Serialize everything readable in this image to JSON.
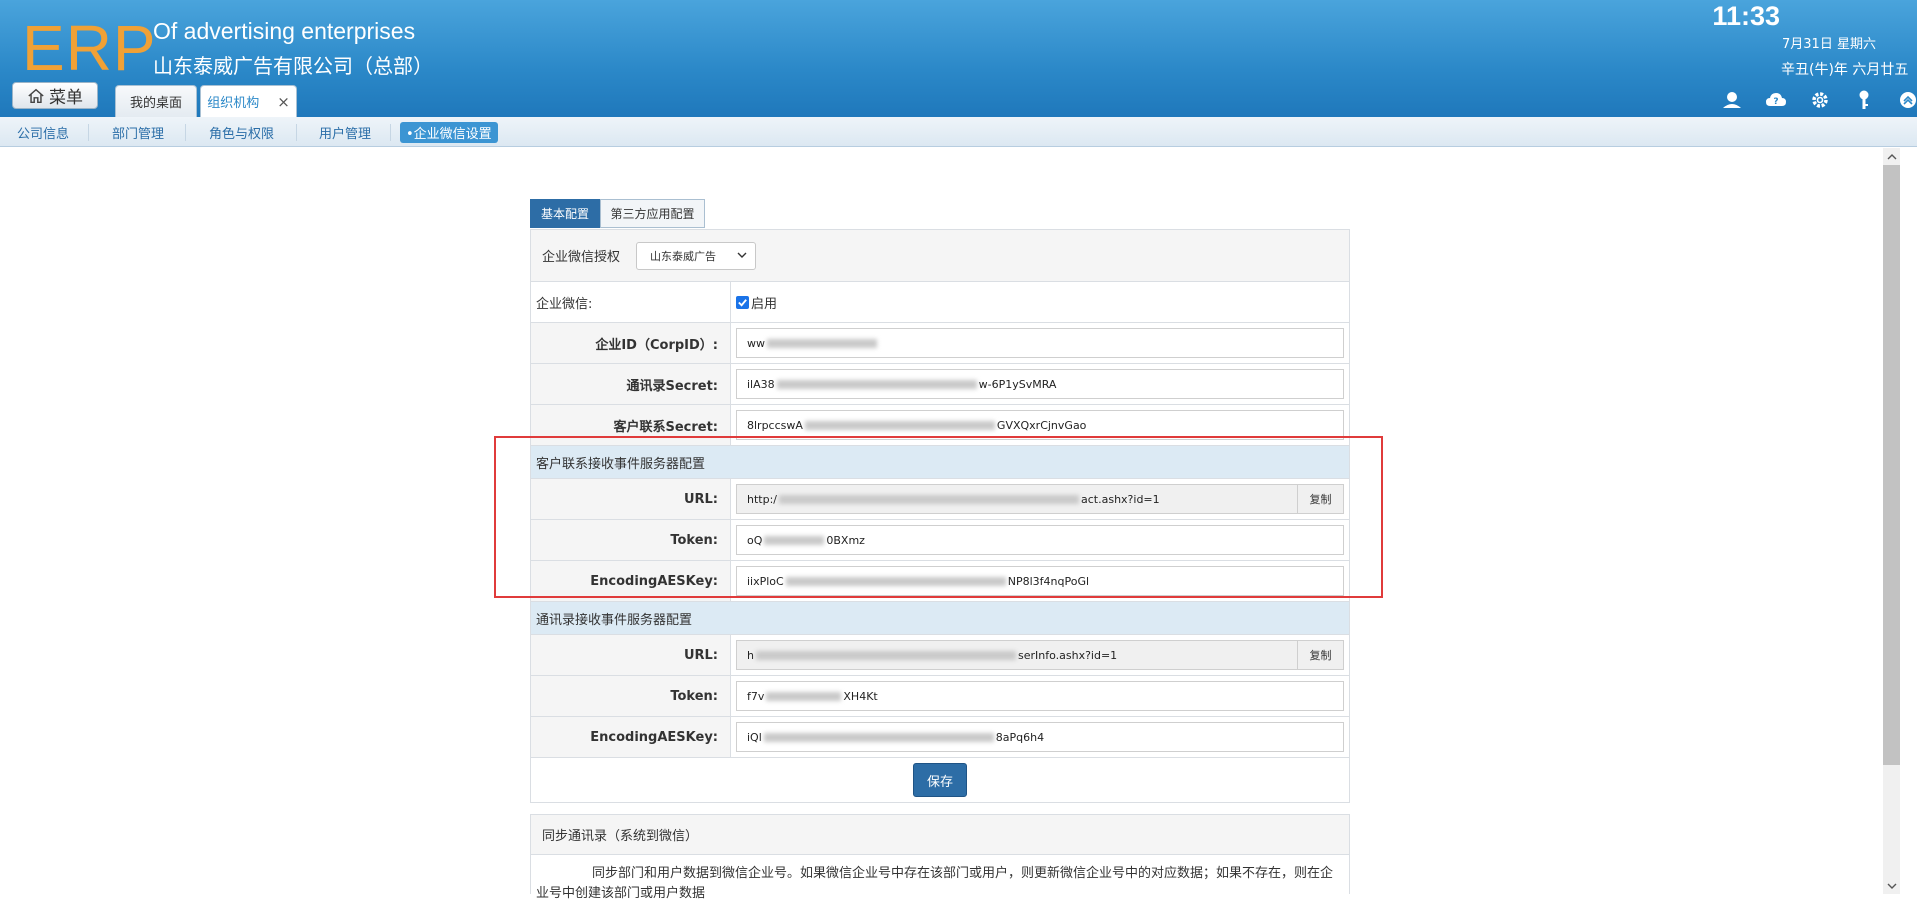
{
  "header": {
    "logo": "ERP",
    "title_en": "Of advertising enterprises",
    "title_cn": "山东泰威广告有限公司（总部）",
    "clock": "11:33",
    "date": "7月31日 星期六",
    "lunar": "辛丑(牛)年 六月廿五",
    "menu_label": "菜单",
    "tabs": [
      {
        "label": "我的桌面"
      },
      {
        "label": "组织机构",
        "close": "×"
      }
    ],
    "icons": [
      "user-icon",
      "cloud-help-icon",
      "gear-icon",
      "key-icon",
      "collapse-up-icon"
    ]
  },
  "subnav": {
    "items": [
      {
        "label": "公司信息"
      },
      {
        "label": "部门管理"
      },
      {
        "label": "角色与权限"
      },
      {
        "label": "用户管理"
      },
      {
        "label": "•企业微信设置"
      }
    ]
  },
  "config_tabs": [
    {
      "label": "基本配置"
    },
    {
      "label": "第三方应用配置"
    }
  ],
  "panel": {
    "auth_label": "企业微信授权",
    "auth_select": "山东泰威广告",
    "enable_label": "企业微信:",
    "enable_text": "启用",
    "corpid_label": "企业ID（CorpID）:",
    "corpid_value": "ww",
    "contacts_secret_label": "通讯录Secret:",
    "contacts_secret_prefix": "ilA38",
    "contacts_secret_suffix": "w-6P1ySvMRA",
    "customer_secret_label": "客户联系Secret:",
    "customer_secret_prefix": "8lrpccswA",
    "customer_secret_suffix": "GVXQxrCjnvGao",
    "section1_title": "客户联系接收事件服务器配置",
    "url_label": "URL:",
    "url1_prefix": "http:/",
    "url1_suffix": "act.ashx?id=1",
    "copy_label": "复制",
    "token_label": "Token:",
    "token1_prefix": "oQ",
    "token1_suffix": "0BXmz",
    "aes_label": "EncodingAESKey:",
    "aes1_prefix": "iixPloC",
    "aes1_suffix": "NP8l3f4nqPoGl",
    "section2_title": "通讯录接收事件服务器配置",
    "url2_prefix": "h",
    "url2_suffix": "serInfo.ashx?id=1",
    "token2_prefix": "f7v",
    "token2_suffix": "XH4Kt",
    "aes2_prefix": "iQl",
    "aes2_suffix": "8aPq6h4",
    "save_label": "保存"
  },
  "sync_panel": {
    "title": "同步通讯录（系统到微信）",
    "body": "同步部门和用户数据到微信企业号。如果微信企业号中存在该部门或用户，则更新微信企业号中的对应数据；如果不存在，则在企业号中创建该部门或用户数据"
  },
  "colors": {
    "header_blue": "#2b88c8",
    "logo_orange": "#f0a136",
    "primary_button": "#2d6da6",
    "highlight_box": "#e03b3b",
    "section_bg": "#dceaf4"
  }
}
